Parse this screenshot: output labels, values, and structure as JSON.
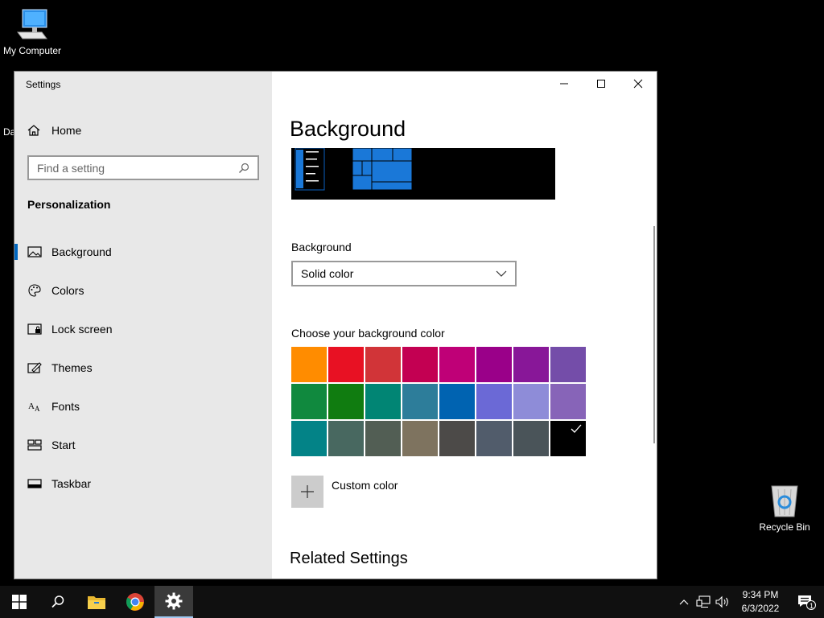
{
  "desktop": {
    "my_computer_label": "My Computer",
    "recycle_bin_label": "Recycle Bin",
    "partial_icon_text": "Da"
  },
  "window": {
    "title": "Settings"
  },
  "sidebar": {
    "home_label": "Home",
    "search_placeholder": "Find a setting",
    "section_title": "Personalization",
    "items": [
      {
        "label": "Background",
        "icon": "image-icon",
        "active": true
      },
      {
        "label": "Colors",
        "icon": "palette-icon",
        "active": false
      },
      {
        "label": "Lock screen",
        "icon": "lock-screen-icon",
        "active": false
      },
      {
        "label": "Themes",
        "icon": "themes-icon",
        "active": false
      },
      {
        "label": "Fonts",
        "icon": "fonts-icon",
        "active": false
      },
      {
        "label": "Start",
        "icon": "start-icon",
        "active": false
      },
      {
        "label": "Taskbar",
        "icon": "taskbar-icon",
        "active": false
      }
    ]
  },
  "main": {
    "page_title": "Background",
    "background_label": "Background",
    "background_value": "Solid color",
    "choose_color_label": "Choose your background color",
    "swatches": [
      "#FF8C00",
      "#E81123",
      "#D13438",
      "#C30052",
      "#BF0077",
      "#9A0089",
      "#881798",
      "#744DA9",
      "#10893E",
      "#107C10",
      "#018574",
      "#2D7D9A",
      "#0063B1",
      "#6B69D6",
      "#8E8CD8",
      "#8764B8",
      "#038387",
      "#486860",
      "#525E54",
      "#7E735F",
      "#4C4A48",
      "#515C6B",
      "#4A5459",
      "#000000"
    ],
    "selected_swatch": "#000000",
    "custom_color_label": "Custom color",
    "related_settings_label": "Related Settings"
  },
  "taskbar": {
    "pinned": [
      "start-icon",
      "search-icon",
      "file-explorer-icon",
      "chrome-icon",
      "settings-icon"
    ],
    "active": "settings-icon",
    "time": "9:34 PM",
    "date": "6/3/2022",
    "notification_count": "1"
  },
  "colors": {
    "accent": "#0067C0",
    "sidebar_bg": "#E8E8E8"
  }
}
